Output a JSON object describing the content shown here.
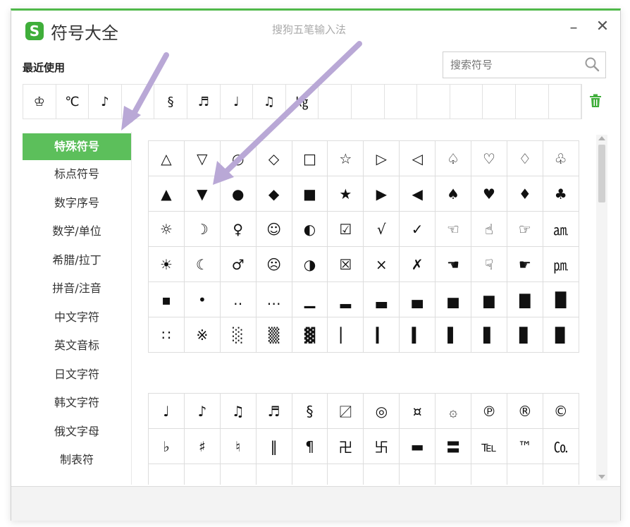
{
  "window": {
    "title": "符号大全",
    "logo_letter": "S",
    "subtitle": "搜狗五笔输入法",
    "minimize_glyph": "–",
    "close_glyph": "✕"
  },
  "recent": {
    "label": "最近使用",
    "items": [
      "♔",
      "℃",
      "♪",
      "",
      "§",
      "♬",
      "♩",
      "♫",
      "㎏",
      "",
      "",
      "",
      "",
      "",
      "",
      "",
      ""
    ]
  },
  "search": {
    "placeholder": "搜索符号",
    "icon": "search-icon"
  },
  "trash_icon": "trash-icon",
  "sidebar": {
    "items": [
      {
        "label": "特殊符号",
        "active": true
      },
      {
        "label": "标点符号",
        "active": false
      },
      {
        "label": "数字序号",
        "active": false
      },
      {
        "label": "数学/单位",
        "active": false
      },
      {
        "label": "希腊/拉丁",
        "active": false
      },
      {
        "label": "拼音/注音",
        "active": false
      },
      {
        "label": "中文字符",
        "active": false
      },
      {
        "label": "英文音标",
        "active": false
      },
      {
        "label": "日文字符",
        "active": false
      },
      {
        "label": "韩文字符",
        "active": false
      },
      {
        "label": "俄文字母",
        "active": false
      },
      {
        "label": "制表符",
        "active": false
      }
    ]
  },
  "grid1": {
    "rows": [
      [
        "△",
        "▽",
        "○",
        "◇",
        "□",
        "☆",
        "▷",
        "◁",
        "♤",
        "♡",
        "♢",
        "♧"
      ],
      [
        "▲",
        "▼",
        "●",
        "◆",
        "■",
        "★",
        "▶",
        "◀",
        "♠",
        "♥",
        "♦",
        "♣"
      ],
      [
        "☼",
        "☽",
        "♀",
        "☺",
        "◐",
        "☑",
        "√",
        "✓",
        "☜",
        "☝",
        "☞",
        "㏂"
      ],
      [
        "☀",
        "☾",
        "♂",
        "☹",
        "◑",
        "☒",
        "×",
        "✗",
        "☚",
        "☟",
        "☛",
        "㏘"
      ],
      [
        "▪",
        "•",
        "‥",
        "…",
        "▁",
        "▂",
        "▃",
        "▄",
        "▅",
        "▆",
        "▇",
        "█"
      ],
      [
        "∷",
        "※",
        "░",
        "▒",
        "▓",
        "▏",
        "▎",
        "▍",
        "▌",
        "▋",
        "▊",
        "▉"
      ]
    ]
  },
  "grid2": {
    "rows": [
      [
        "♩",
        "♪",
        "♫",
        "♬",
        "§",
        "〼",
        "◎",
        "¤",
        "۞",
        "℗",
        "®",
        "©"
      ],
      [
        "♭",
        "♯",
        "♮",
        "‖",
        "¶",
        "卍",
        "卐",
        "▬",
        "〓",
        "℡",
        "™",
        "㏇"
      ],
      [
        "",
        "",
        "",
        "",
        "",
        "",
        "",
        "",
        "",
        "",
        "",
        ""
      ]
    ]
  },
  "colors": {
    "accent": "#5cbf5b",
    "arrow": "#b9a8d6"
  }
}
